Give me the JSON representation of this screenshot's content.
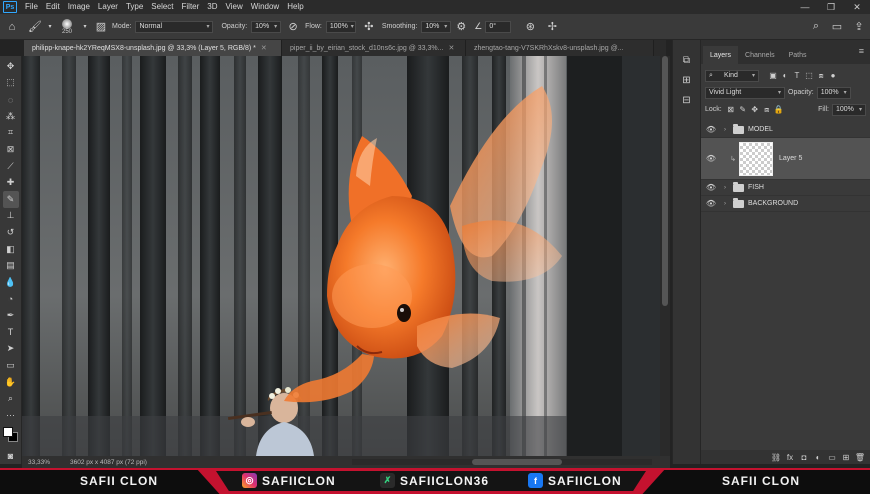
{
  "menu": {
    "items": [
      "File",
      "Edit",
      "Image",
      "Layer",
      "Type",
      "Select",
      "Filter",
      "3D",
      "View",
      "Window",
      "Help"
    ]
  },
  "options": {
    "brush_size": "250",
    "mode_label": "Mode:",
    "mode_value": "Normal",
    "opacity_label": "Opacity:",
    "opacity_value": "10%",
    "flow_label": "Flow:",
    "flow_value": "100%",
    "smoothing_label": "Smoothing:",
    "smoothing_value": "10%",
    "angle_value": "0°"
  },
  "tabs": [
    {
      "label": "philipp-knape-hk2YReqMSX8-unsplash.jpg @ 33,3% (Layer 5, RGB/8) *"
    },
    {
      "label": "piper_ii_by_eirian_stock_d10ns6c.jpg @ 33,3%..."
    },
    {
      "label": "zhengtao-tang-V7SKRhXskv8-unsplash.jpg @..."
    }
  ],
  "status": {
    "zoom": "33,33%",
    "dims": "3602 px x 4087 px (72 ppi)"
  },
  "layers_panel": {
    "tabs": [
      "Layers",
      "Channels",
      "Paths"
    ],
    "filter_value": "Kind",
    "blend_mode": "Vivid Light",
    "opacity_label": "Opacity:",
    "opacity_value": "100%",
    "lock_label": "Lock:",
    "fill_label": "Fill:",
    "fill_value": "100%",
    "layers": [
      {
        "name": "MODEL",
        "type": "group"
      },
      {
        "name": "Layer 5",
        "type": "layer",
        "selected": true
      },
      {
        "name": "FISH",
        "type": "group"
      },
      {
        "name": "BACKGROUND",
        "type": "group"
      }
    ]
  },
  "banner": {
    "left_text": "SAFII CLON",
    "instagram": "SAFIICLON",
    "other_social": "SAFIICLON36",
    "facebook": "SAFIICLON",
    "right_text": "SAFII CLON",
    "colors": {
      "accent": "#c4122f",
      "dark": "#0d0d0d"
    }
  }
}
